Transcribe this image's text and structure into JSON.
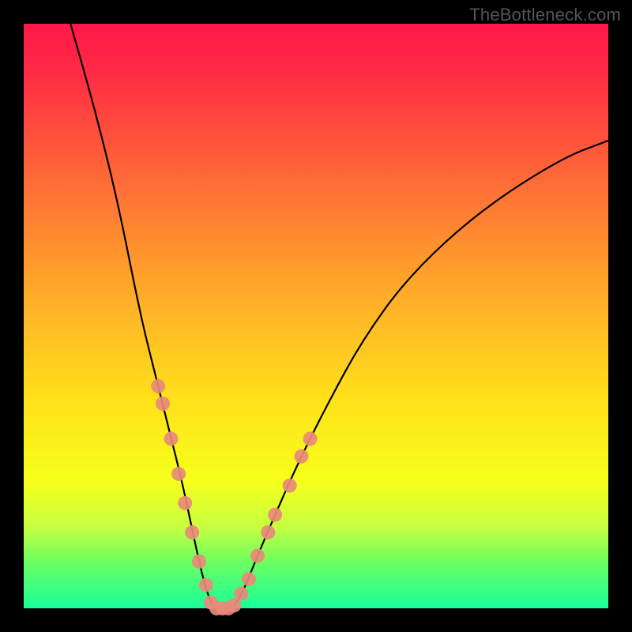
{
  "watermark": "TheBottleneck.com",
  "colors": {
    "frame": "#000000",
    "gradient_top": "#ff1848",
    "gradient_bottom": "#18ff9a",
    "curve": "#000000",
    "markers": "#e88a7a"
  },
  "chart_data": {
    "type": "line",
    "title": "",
    "xlabel": "",
    "ylabel": "",
    "xlim": [
      0,
      100
    ],
    "ylim": [
      0,
      100
    ],
    "series": [
      {
        "name": "curve",
        "x": [
          8,
          12,
          16,
          20,
          22.5,
          25,
          27,
          28.5,
          30,
          31,
          32,
          33,
          34,
          35,
          36,
          37,
          38,
          40,
          43,
          47,
          52,
          58,
          66,
          78,
          92,
          100
        ],
        "y": [
          100,
          86,
          70,
          50,
          40,
          30,
          22,
          15,
          8,
          4,
          1,
          0,
          0,
          0,
          0.5,
          2,
          4,
          9,
          16,
          25,
          35,
          46,
          57,
          68,
          77,
          80
        ]
      }
    ],
    "markers_left": [
      {
        "x": 23.0,
        "y": 38
      },
      {
        "x": 23.8,
        "y": 35
      },
      {
        "x": 25.2,
        "y": 29
      },
      {
        "x": 26.5,
        "y": 23
      },
      {
        "x": 27.6,
        "y": 18
      },
      {
        "x": 28.8,
        "y": 13
      },
      {
        "x": 30.0,
        "y": 8
      },
      {
        "x": 31.2,
        "y": 4
      },
      {
        "x": 32.0,
        "y": 1
      }
    ],
    "markers_bottom": [
      {
        "x": 33.0,
        "y": 0
      },
      {
        "x": 34.0,
        "y": 0
      },
      {
        "x": 35.0,
        "y": 0
      },
      {
        "x": 36.0,
        "y": 0.5
      }
    ],
    "markers_right": [
      {
        "x": 37.2,
        "y": 2.5
      },
      {
        "x": 38.5,
        "y": 5
      },
      {
        "x": 40.0,
        "y": 9
      },
      {
        "x": 41.8,
        "y": 13
      },
      {
        "x": 43.0,
        "y": 16
      },
      {
        "x": 45.5,
        "y": 21
      },
      {
        "x": 47.5,
        "y": 26
      },
      {
        "x": 49.0,
        "y": 29
      }
    ]
  }
}
